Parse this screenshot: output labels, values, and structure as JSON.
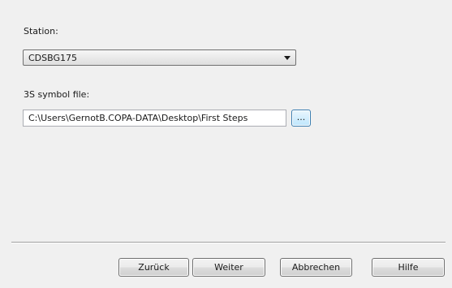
{
  "station": {
    "label": "Station:",
    "selected": "CDSBG175"
  },
  "symbol_file": {
    "label": "3S symbol file:",
    "value": "C:\\Users\\GernotB.COPA-DATA\\Desktop\\First Steps",
    "browse_label": "..."
  },
  "buttons": {
    "back": "Zurück",
    "next": "Weiter",
    "cancel": "Abbrechen",
    "help": "Hilfe"
  }
}
